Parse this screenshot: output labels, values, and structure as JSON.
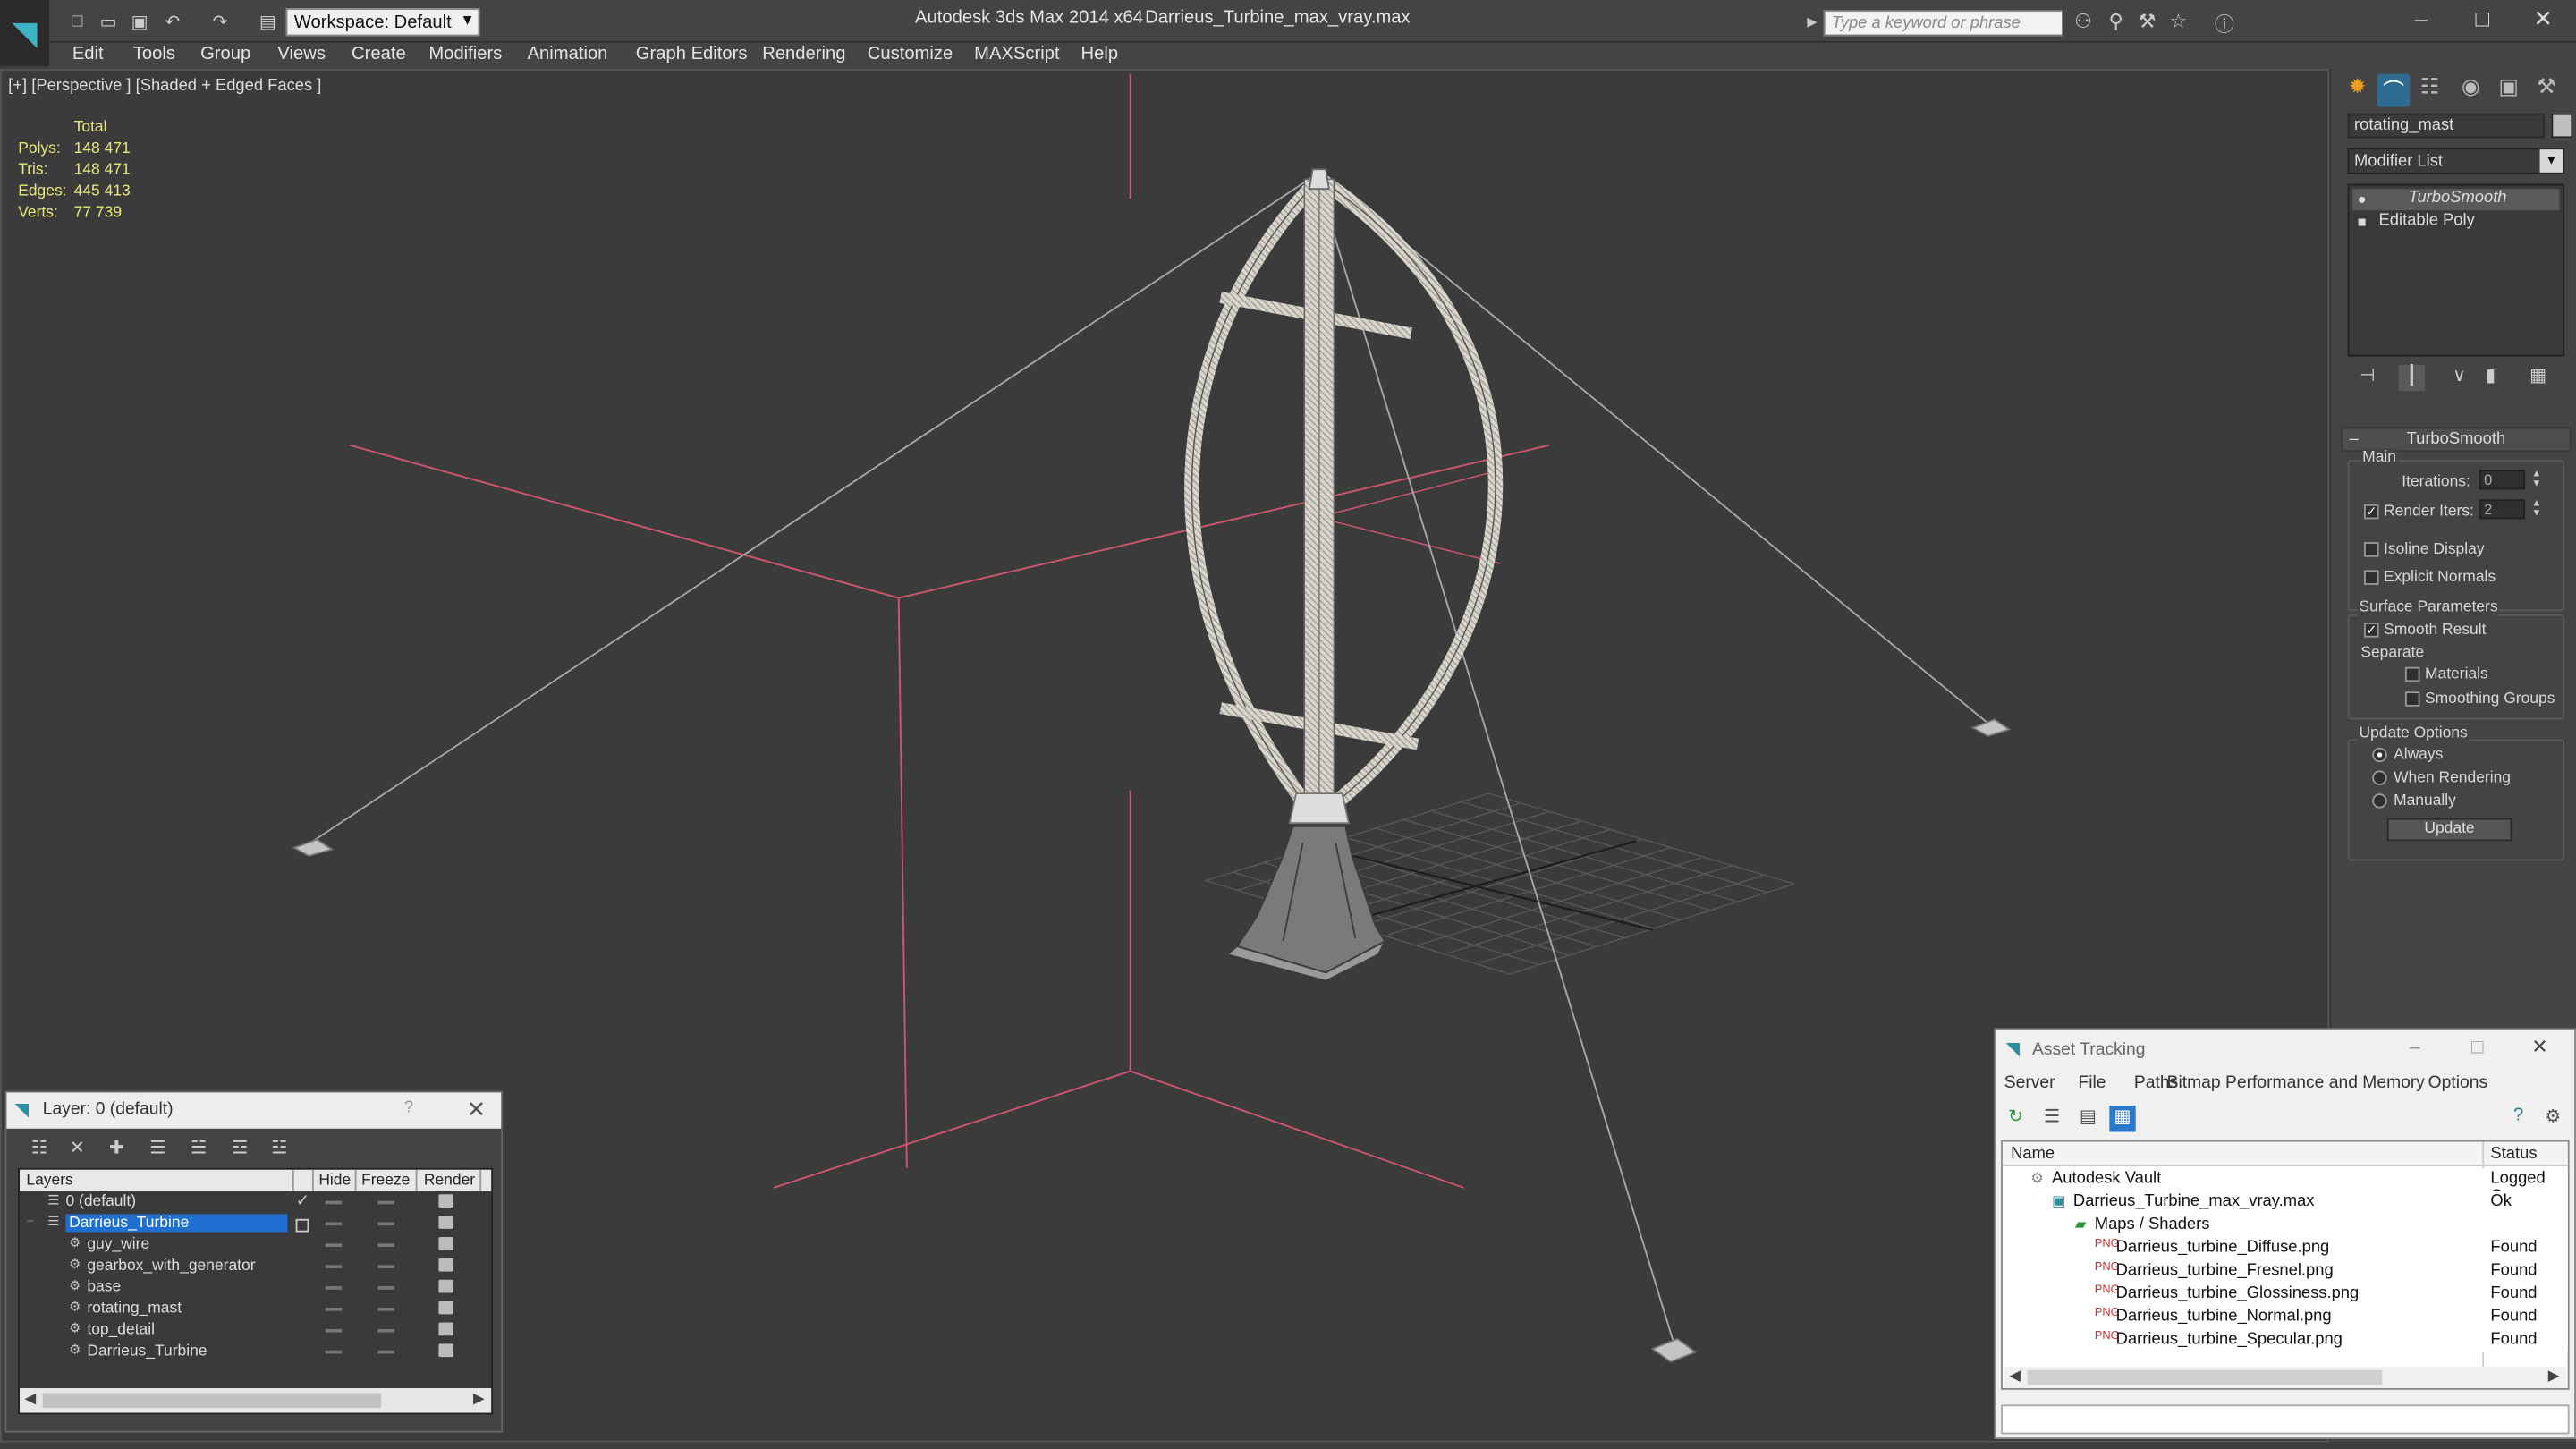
{
  "titlebar": {
    "workspace": "Workspace: Default",
    "app_title": "Autodesk 3ds Max  2014 x64",
    "filename": "Darrieus_Turbine_max_vray.max",
    "search_placeholder": "Type a keyword or phrase",
    "quick_access_icons": [
      "new-file-icon",
      "open-file-icon",
      "save-icon",
      "undo-icon",
      "redo-icon",
      "project-folder-icon"
    ],
    "search_icons": [
      "binoculars-icon",
      "key-icon",
      "exchange-icon",
      "star-icon",
      "help-icon"
    ]
  },
  "menu": [
    "Edit",
    "Tools",
    "Group",
    "Views",
    "Create",
    "Modifiers",
    "Animation",
    "Graph Editors",
    "Rendering",
    "Customize",
    "MAXScript",
    "Help"
  ],
  "viewport": {
    "label": "[+] [Perspective ] [Shaded + Edged Faces ]",
    "stats": {
      "header": "Total",
      "rows": [
        {
          "label": "Polys:",
          "value": "148 471"
        },
        {
          "label": "Tris:",
          "value": "148 471"
        },
        {
          "label": "Edges:",
          "value": "445 413"
        },
        {
          "label": "Verts:",
          "value": "77 739"
        }
      ]
    }
  },
  "command_panel": {
    "object_name": "rotating_mast",
    "modifier_list": "Modifier List",
    "stack": [
      "TurboSmooth",
      "Editable Poly"
    ],
    "rollout_title": "TurboSmooth",
    "main_label": "Main",
    "iterations_label": "Iterations:",
    "iterations_value": "0",
    "render_iters_label": "Render Iters:",
    "render_iters_value": "2",
    "isoline_label": "Isoline Display",
    "explicit_normals_label": "Explicit Normals",
    "surface_params_label": "Surface Parameters",
    "smooth_result_label": "Smooth Result",
    "separate_label": "Separate",
    "materials_label": "Materials",
    "smoothing_groups_label": "Smoothing Groups",
    "update_options_label": "Update Options",
    "always_label": "Always",
    "when_rendering_label": "When Rendering",
    "manually_label": "Manually",
    "update_button": "Update"
  },
  "layer_window": {
    "title": "Layer: 0 (default)",
    "columns": [
      "Layers",
      "Hide",
      "Freeze",
      "Render"
    ],
    "rows": [
      {
        "name": "0 (default)",
        "indent": 1,
        "selected": false
      },
      {
        "name": "Darrieus_Turbine",
        "indent": 1,
        "selected": true
      },
      {
        "name": "guy_wire",
        "indent": 2,
        "selected": false
      },
      {
        "name": "gearbox_with_generator",
        "indent": 2,
        "selected": false
      },
      {
        "name": "base",
        "indent": 2,
        "selected": false
      },
      {
        "name": "rotating_mast",
        "indent": 2,
        "selected": false
      },
      {
        "name": "top_detail",
        "indent": 2,
        "selected": false
      },
      {
        "name": "Darrieus_Turbine",
        "indent": 2,
        "selected": false
      }
    ]
  },
  "asset_tracking": {
    "title": "Asset Tracking",
    "menu": [
      "Server",
      "File",
      "Paths",
      "Bitmap Performance and Memory",
      "Options"
    ],
    "columns": [
      "Name",
      "Status"
    ],
    "rows": [
      {
        "name": "Autodesk Vault",
        "status": "Logged Ou",
        "icon": "vault-icon"
      },
      {
        "name": "Darrieus_Turbine_max_vray.max",
        "status": "Ok",
        "icon": "max-file-icon"
      },
      {
        "name": "Maps / Shaders",
        "status": "",
        "icon": "folder-icon"
      },
      {
        "name": "Darrieus_turbine_Diffuse.png",
        "status": "Found",
        "icon": "png-icon"
      },
      {
        "name": "Darrieus_turbine_Fresnel.png",
        "status": "Found",
        "icon": "png-icon"
      },
      {
        "name": "Darrieus_turbine_Glossiness.png",
        "status": "Found",
        "icon": "png-icon"
      },
      {
        "name": "Darrieus_turbine_Normal.png",
        "status": "Found",
        "icon": "png-icon"
      },
      {
        "name": "Darrieus_turbine_Specular.png",
        "status": "Found",
        "icon": "png-icon"
      }
    ]
  },
  "colors": {
    "accent": "#2a8fa0",
    "selection": "#1f6fd1",
    "stats_text": "#e8e87a",
    "gizmo": "#d2566f"
  }
}
